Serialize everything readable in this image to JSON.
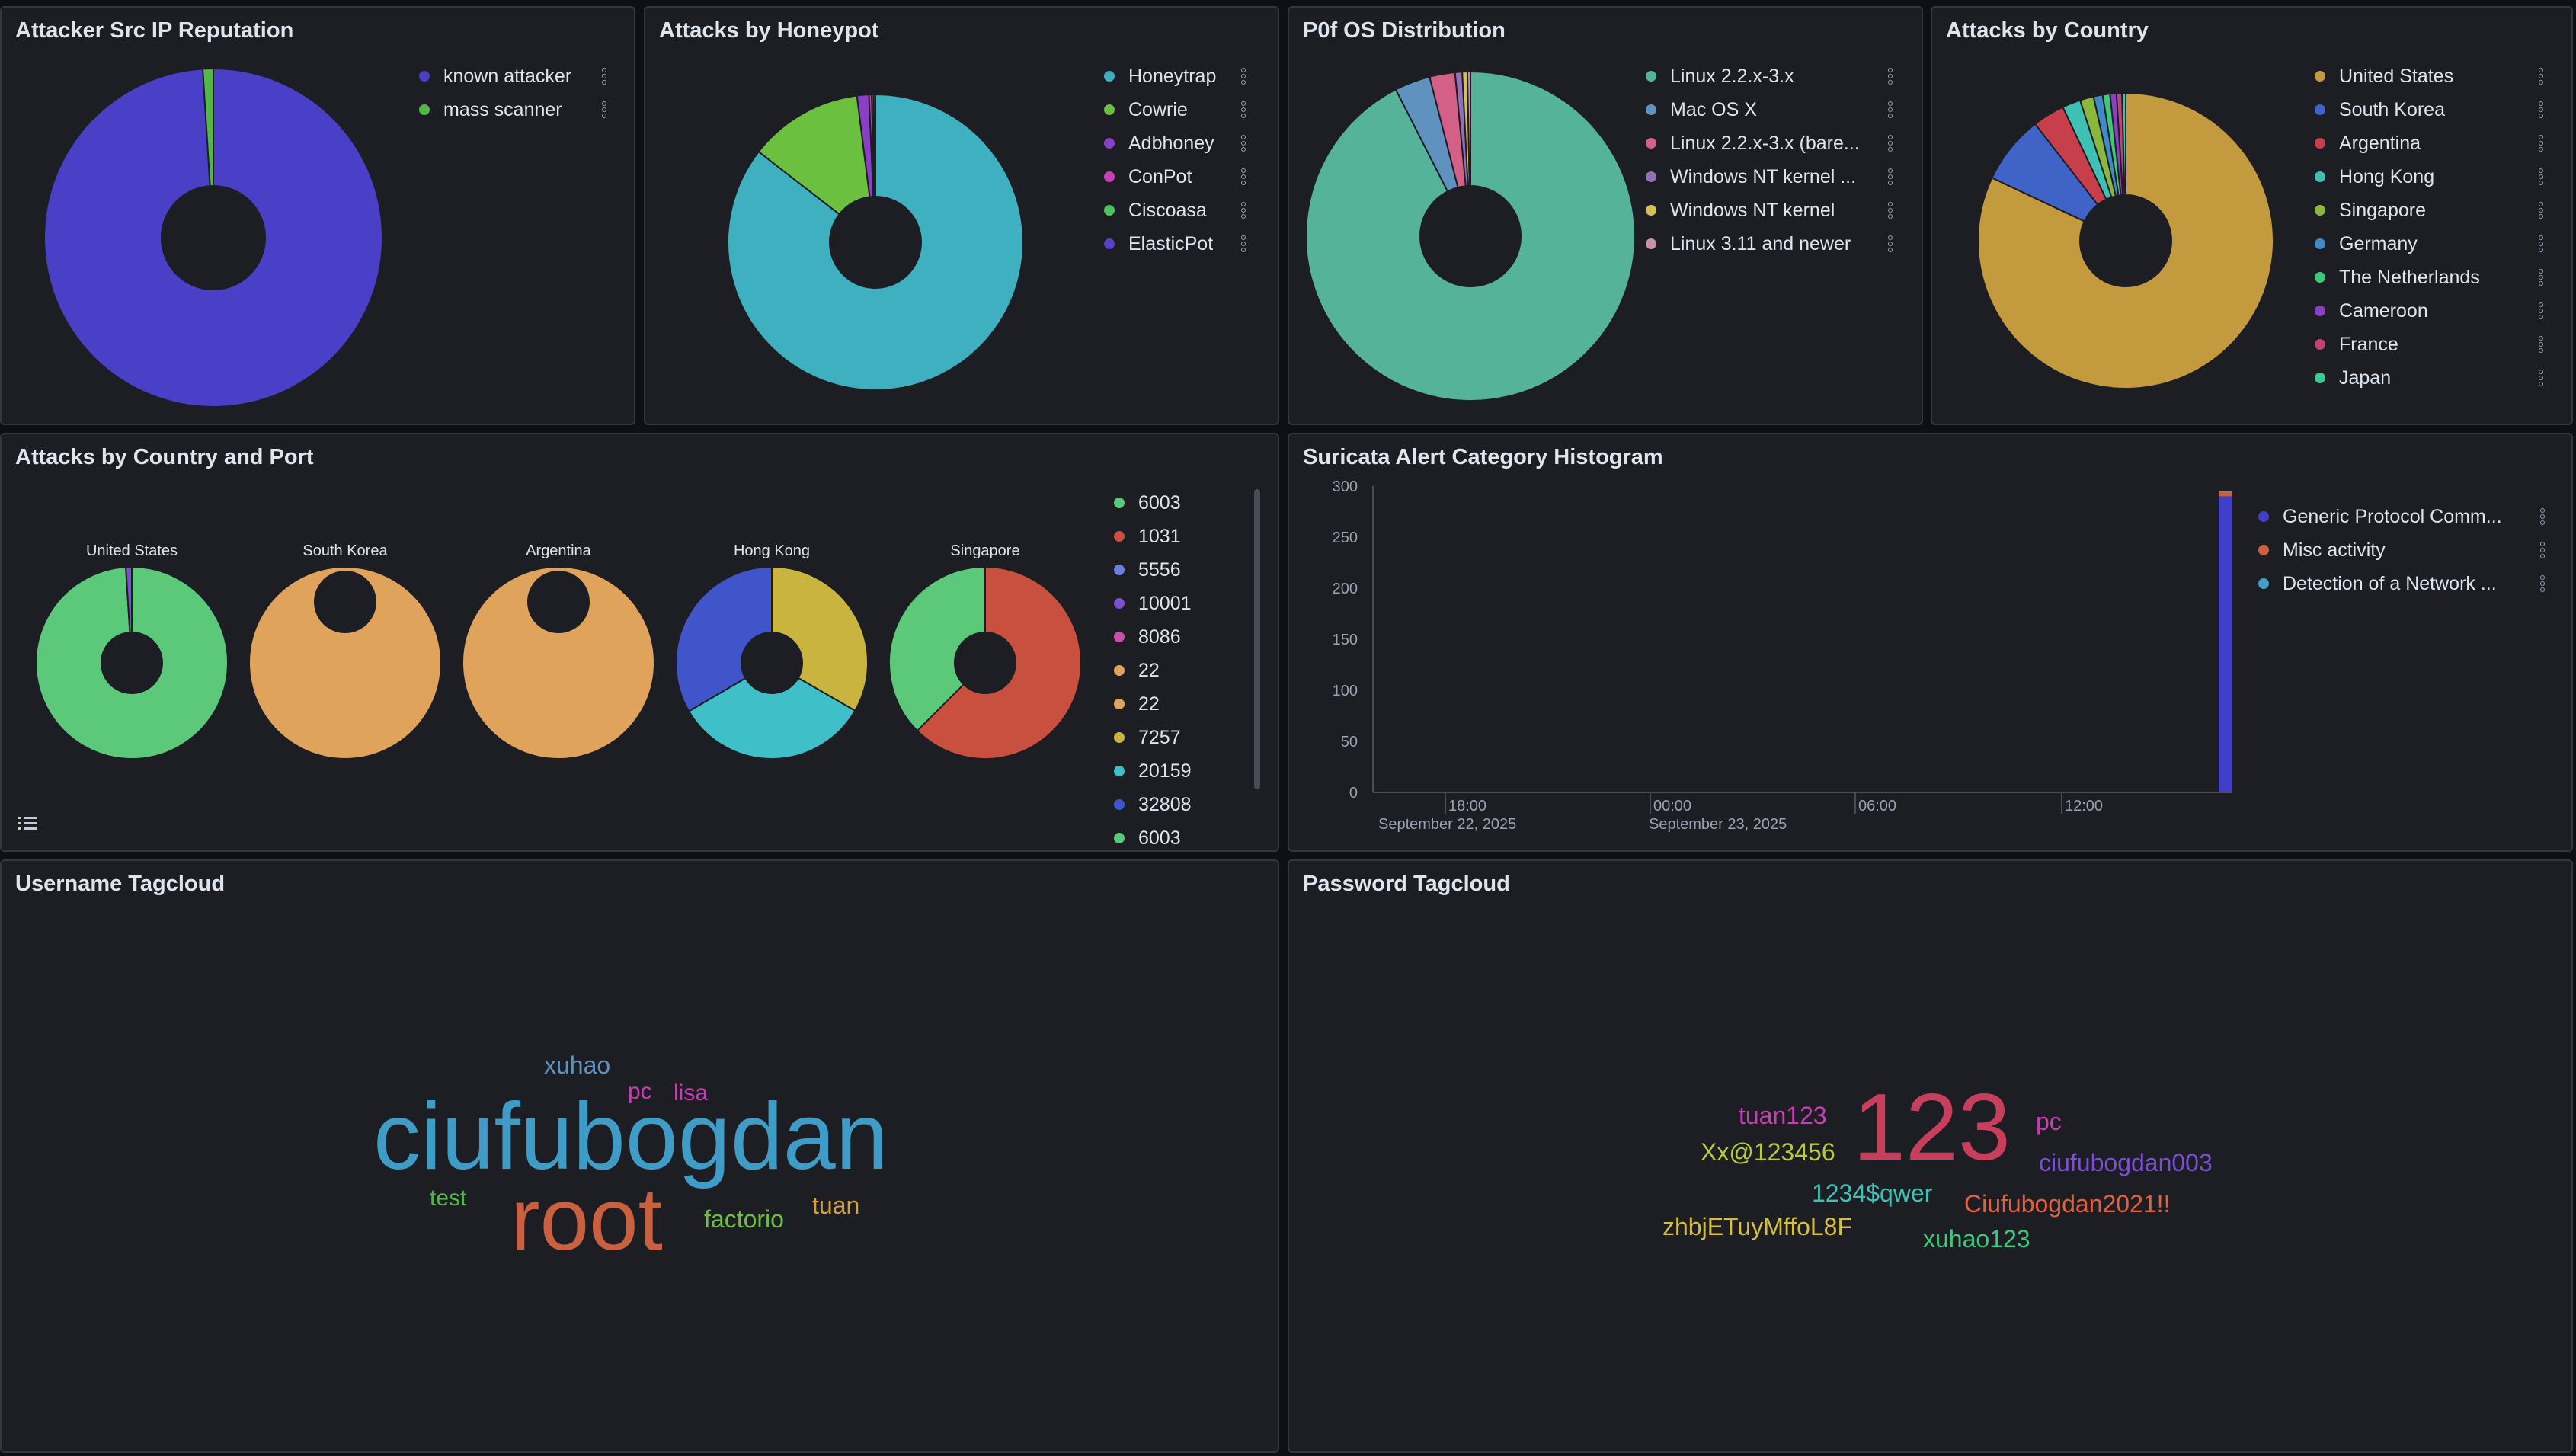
{
  "panels": {
    "reputation": {
      "title": "Attacker Src IP Reputation",
      "legend": [
        {
          "label": "known attacker",
          "color": "#4a3fc7"
        },
        {
          "label": "mass scanner",
          "color": "#54b848"
        }
      ]
    },
    "honeypot": {
      "title": "Attacks by Honeypot",
      "legend": [
        {
          "label": "Honeytrap",
          "color": "#3fb0c0"
        },
        {
          "label": "Cowrie",
          "color": "#6cc040"
        },
        {
          "label": "Adbhoney",
          "color": "#8a3fc7"
        },
        {
          "label": "ConPot",
          "color": "#c63fb3"
        },
        {
          "label": "Ciscoasa",
          "color": "#4cc45c"
        },
        {
          "label": "ElasticPot",
          "color": "#5a3fc7"
        }
      ]
    },
    "p0f": {
      "title": "P0f OS Distribution",
      "legend": [
        {
          "label": "Linux 2.2.x-3.x",
          "color": "#54b399"
        },
        {
          "label": "Mac OS X",
          "color": "#6092c0"
        },
        {
          "label": "Linux 2.2.x-3.x (bare...",
          "color": "#d36086"
        },
        {
          "label": "Windows NT kernel ...",
          "color": "#9170b8"
        },
        {
          "label": "Windows NT kernel",
          "color": "#d6bf57"
        },
        {
          "label": "Linux 3.11 and newer",
          "color": "#ca8eae"
        }
      ]
    },
    "country": {
      "title": "Attacks by Country",
      "legend": [
        {
          "label": "United States",
          "color": "#c49a3f"
        },
        {
          "label": "South Korea",
          "color": "#3f63c7"
        },
        {
          "label": "Argentina",
          "color": "#c73f4a"
        },
        {
          "label": "Hong Kong",
          "color": "#3fc0b4"
        },
        {
          "label": "Singapore",
          "color": "#8ab83f"
        },
        {
          "label": "Germany",
          "color": "#3f8ac7"
        },
        {
          "label": "The Netherlands",
          "color": "#3fc77a"
        },
        {
          "label": "Cameroon",
          "color": "#8a3fc7"
        },
        {
          "label": "France",
          "color": "#c73f7a"
        },
        {
          "label": "Japan",
          "color": "#3fc794"
        }
      ]
    },
    "country_port": {
      "title": "Attacks by Country and Port",
      "charts": [
        {
          "label": "United States"
        },
        {
          "label": "South Korea"
        },
        {
          "label": "Argentina"
        },
        {
          "label": "Hong Kong"
        },
        {
          "label": "Singapore"
        }
      ],
      "legend": [
        {
          "label": "6003",
          "color": "#5bc87a"
        },
        {
          "label": "1031",
          "color": "#c9503f"
        },
        {
          "label": "5556",
          "color": "#6b7fe0"
        },
        {
          "label": "10001",
          "color": "#7a4fd0"
        },
        {
          "label": "8086",
          "color": "#c94fa8"
        },
        {
          "label": "22",
          "color": "#e0a35b"
        },
        {
          "label": "22",
          "color": "#e0a35b"
        },
        {
          "label": "7257",
          "color": "#c9b43f"
        },
        {
          "label": "20159",
          "color": "#3fc0c9"
        },
        {
          "label": "32808",
          "color": "#3f55c9"
        },
        {
          "label": "6003",
          "color": "#5bc87a"
        }
      ]
    },
    "suricata": {
      "title": "Suricata Alert Category Histogram",
      "legend": [
        {
          "label": "Generic Protocol Comm...",
          "color": "#3f3fc7"
        },
        {
          "label": "Misc activity",
          "color": "#c9603f"
        },
        {
          "label": "Detection of a Network ...",
          "color": "#3fa0c9"
        }
      ],
      "x_ticks": [
        {
          "line1": "18:00",
          "line2": "September 22, 2025"
        },
        {
          "line1": "00:00",
          "line2": "September 23, 2025"
        },
        {
          "line1": "06:00",
          "line2": ""
        },
        {
          "line1": "12:00",
          "line2": ""
        }
      ]
    },
    "username": {
      "title": "Username Tagcloud",
      "tags": [
        {
          "text": "xuhao",
          "color": "#6092c0"
        },
        {
          "text": "pc",
          "color": "#c63fb3"
        },
        {
          "text": "lisa",
          "color": "#c63fb3"
        },
        {
          "text": "ciufubogdan",
          "color": "#3f9cc7"
        },
        {
          "text": "test",
          "color": "#54b848"
        },
        {
          "text": "root",
          "color": "#c9603f"
        },
        {
          "text": "factorio",
          "color": "#6cc040"
        },
        {
          "text": "tuan",
          "color": "#d6a03f"
        }
      ]
    },
    "password": {
      "title": "Password Tagcloud",
      "tags": [
        {
          "text": "tuan123",
          "color": "#c63fb3"
        },
        {
          "text": "123",
          "color": "#c73f5a"
        },
        {
          "text": "pc",
          "color": "#c63fb3"
        },
        {
          "text": "Xx@123456",
          "color": "#b8c83f"
        },
        {
          "text": "ciufubogdan003",
          "color": "#7a4fd0"
        },
        {
          "text": "1234$qwer",
          "color": "#3fc0b4"
        },
        {
          "text": "zhbjETuyMffoL8F",
          "color": "#d6bf3f"
        },
        {
          "text": "Ciufubogdan2021!!",
          "color": "#e0603f"
        },
        {
          "text": "xuhao123",
          "color": "#3fc77a"
        }
      ]
    }
  },
  "chart_data": [
    {
      "type": "pie",
      "title": "Attacker Src IP Reputation",
      "categories": [
        "known attacker",
        "mass scanner"
      ],
      "values": [
        99,
        1
      ]
    },
    {
      "type": "pie",
      "title": "Attacks by Honeypot",
      "categories": [
        "Honeytrap",
        "Cowrie",
        "Adbhoney",
        "ConPot",
        "Ciscoasa",
        "ElasticPot"
      ],
      "values": [
        85.5,
        12.5,
        1.3,
        0.3,
        0.2,
        0.2
      ]
    },
    {
      "type": "pie",
      "title": "P0f OS Distribution",
      "categories": [
        "Linux 2.2.x-3.x",
        "Mac OS X",
        "Linux 2.2.x-3.x (bare...",
        "Windows NT kernel ...",
        "Windows NT kernel",
        "Linux 3.11 and newer"
      ],
      "values": [
        92.5,
        3.5,
        2.5,
        0.7,
        0.5,
        0.3
      ]
    },
    {
      "type": "pie",
      "title": "Attacks by Country",
      "categories": [
        "United States",
        "South Korea",
        "Argentina",
        "Hong Kong",
        "Singapore",
        "Germany",
        "The Netherlands",
        "Cameroon",
        "France",
        "Japan"
      ],
      "values": [
        82,
        7.5,
        3.5,
        2,
        1.5,
        1,
        0.8,
        0.7,
        0.6,
        0.4
      ]
    },
    {
      "type": "pie",
      "title": "Attacks by Country and Port",
      "groups": [
        {
          "name": "United States",
          "slices": [
            {
              "label": "6003",
              "value": 99
            },
            {
              "label": "10001",
              "value": 1
            }
          ]
        },
        {
          "name": "South Korea",
          "slices": [
            {
              "label": "22",
              "value": 100
            }
          ]
        },
        {
          "name": "Argentina",
          "slices": [
            {
              "label": "22",
              "value": 100
            }
          ]
        },
        {
          "name": "Hong Kong",
          "slices": [
            {
              "label": "7257",
              "value": 33.3
            },
            {
              "label": "20159",
              "value": 33.3
            },
            {
              "label": "32808",
              "value": 33.4
            }
          ]
        },
        {
          "name": "Singapore",
          "slices": [
            {
              "label": "1031",
              "value": 62.5
            },
            {
              "label": "6003",
              "value": 37.5
            }
          ]
        }
      ]
    },
    {
      "type": "bar",
      "title": "Suricata Alert Category Histogram",
      "y_ticks": [
        0,
        50,
        100,
        150,
        200,
        250,
        300
      ],
      "ylim": [
        0,
        300
      ],
      "series": [
        {
          "name": "Generic Protocol Comm...",
          "values": [
            290
          ]
        },
        {
          "name": "Misc activity",
          "values": [
            4
          ]
        },
        {
          "name": "Detection of a Network ...",
          "values": [
            1
          ]
        }
      ]
    }
  ]
}
